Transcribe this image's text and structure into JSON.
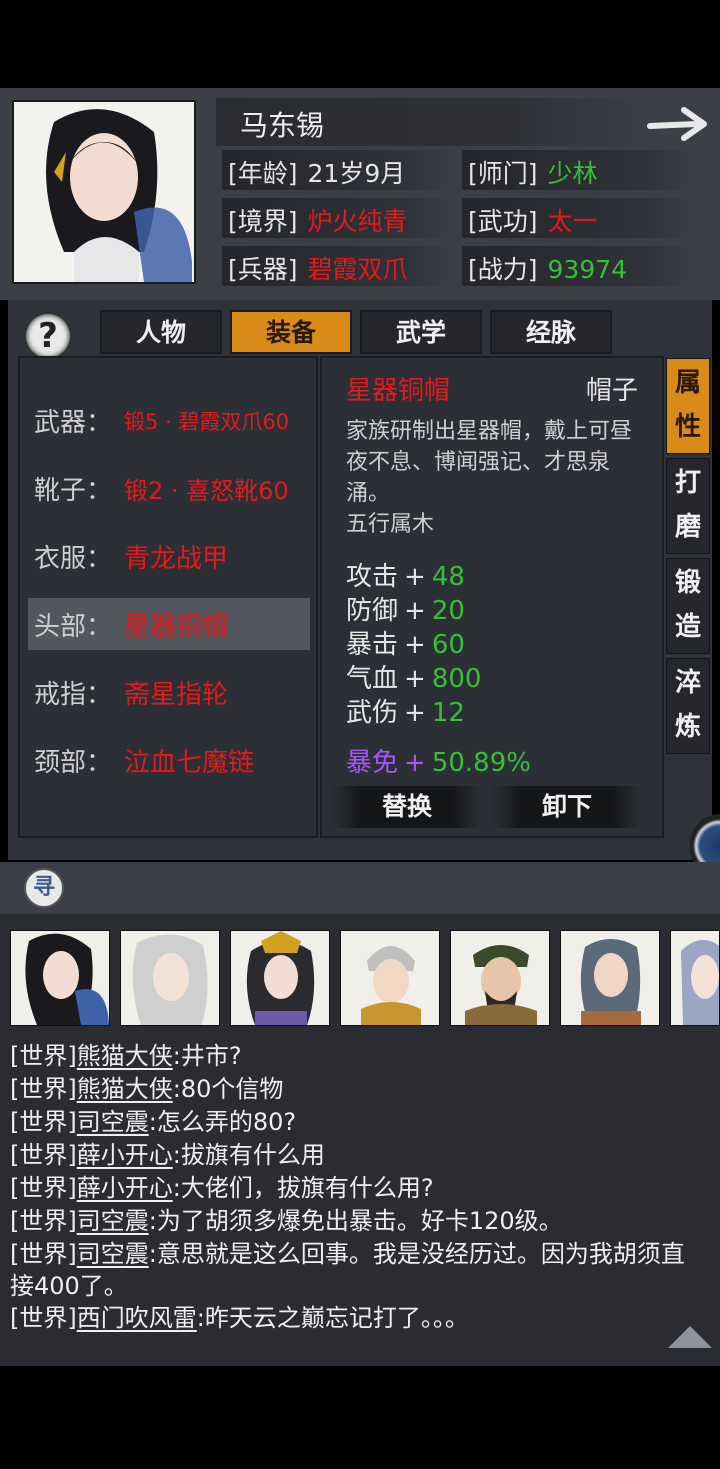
{
  "character": {
    "name": "马东锡",
    "stats": [
      {
        "label": "[年龄]",
        "value": "21岁9月",
        "color": "#e6e6e6"
      },
      {
        "label": "[师门]",
        "value": "少林",
        "color": "#35c035"
      },
      {
        "label": "[境界]",
        "value": "炉火纯青",
        "color": "#e41a1a"
      },
      {
        "label": "[武功]",
        "value": "太一",
        "color": "#e41a1a"
      },
      {
        "label": "[兵器]",
        "value": "碧霞双爪",
        "color": "#e41a1a"
      },
      {
        "label": "[战力]",
        "value": "93974",
        "color": "#35c035"
      }
    ]
  },
  "tabs": [
    "人物",
    "装备",
    "武学",
    "经脉"
  ],
  "active_tab": "装备",
  "equipment": [
    {
      "label": "武器：",
      "value": "锻5 · 碧霞双爪60"
    },
    {
      "label": "靴子：",
      "value": "锻2 · 喜怒靴60"
    },
    {
      "label": "衣服：",
      "value": "青龙战甲"
    },
    {
      "label": "头部：",
      "value": "星器铜帽"
    },
    {
      "label": "戒指：",
      "value": "斋星指轮"
    },
    {
      "label": "颈部：",
      "value": "泣血七魔链"
    }
  ],
  "selected_slot": "头部：",
  "item": {
    "name": "星器铜帽",
    "type": "帽子",
    "description": "家族研制出星器帽，戴上可昼夜不息、博闻强记、才思泉涌。",
    "element": "五行属木",
    "attributes": [
      {
        "label": "攻击",
        "value": "48"
      },
      {
        "label": "防御",
        "value": "20"
      },
      {
        "label": "暴击",
        "value": "60"
      },
      {
        "label": "气血",
        "value": "800"
      },
      {
        "label": "武伤",
        "value": "12"
      }
    ],
    "special": {
      "label": "暴免",
      "value": "50.89%"
    }
  },
  "actions": {
    "replace": "替换",
    "unequip": "卸下"
  },
  "side_tabs": [
    "属性",
    "打磨",
    "锻造",
    "淬炼"
  ],
  "search_glyph": "寻",
  "help_glyph": "?",
  "chat": [
    {
      "channel": "[世界]",
      "user": "熊猫大侠",
      "text": ":井市?"
    },
    {
      "channel": "[世界]",
      "user": "熊猫大侠",
      "text": ":80个信物"
    },
    {
      "channel": "[世界]",
      "user": "司空震",
      "text": ":怎么弄的80?"
    },
    {
      "channel": "[世界]",
      "user": "薛小开心",
      "text": ":拔旗有什么用"
    },
    {
      "channel": "[世界]",
      "user": "薛小开心",
      "text": ":大佬们，拔旗有什么用?"
    },
    {
      "channel": "[世界]",
      "user": "司空震",
      "text": ":为了胡须多爆免出暴击。好卡120级。"
    },
    {
      "channel": "[世界]",
      "user": "司空震",
      "text": ":意思就是这么回事。我是没经历过。因为我胡须直"
    },
    {
      "channel": "",
      "user": "",
      "text": "接400了。"
    },
    {
      "channel": "[世界]",
      "user": "西门吹风雷",
      "text": ":昨天云之巅忘记打了。。。"
    }
  ],
  "colors": {
    "accent": "#d98a18",
    "red": "#e41a1a",
    "green": "#35c035",
    "purple": "#a855f7"
  }
}
